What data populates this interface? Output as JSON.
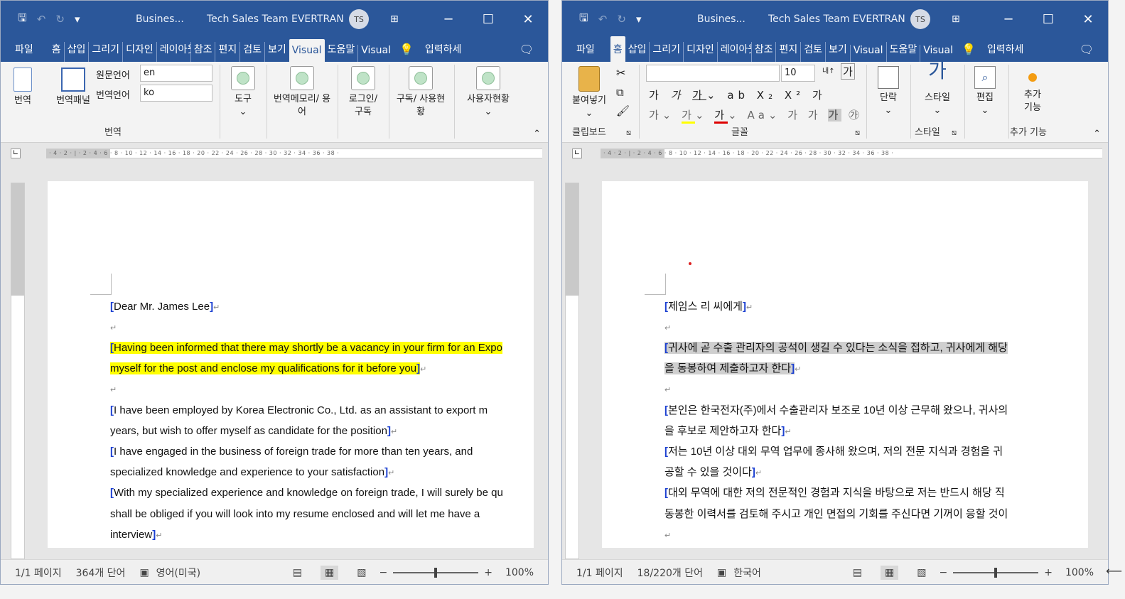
{
  "left": {
    "title": {
      "doc": "Busines...",
      "team": "Tech Sales Team EVERTRAN",
      "avatar": "TS"
    },
    "tabs": [
      "파일",
      "홈",
      "삽입",
      "그리기",
      "디자인",
      "레이아웃",
      "참조",
      "편지",
      "검토",
      "보기",
      "Visual",
      "도움말",
      "Visual"
    ],
    "active_tab_index": 10,
    "tellme": "입력하세",
    "ribbon": {
      "translate_label": "번역",
      "translate_pane_label": "번역패널",
      "source_lang_label": "원문언어",
      "source_lang_value": "en",
      "target_lang_label": "번역언어",
      "target_lang_value": "ko",
      "group_label": "번역",
      "tools_label": "도구",
      "memory_label": "번역메모리/ 용어",
      "login_label": "로그인/ 구독",
      "subscribe_label": "구독/ 사용현황",
      "usage_label": "사용자현황"
    },
    "doc": {
      "p1": "Dear Mr. James Lee",
      "p2a": "Having been informed that there may shortly be a vacancy in your firm for an Expo",
      "p2b": "myself for the post and enclose my qualifications for it before you",
      "p3a": "I have been employed by Korea Electronic Co., Ltd. as an assistant to export m",
      "p3b": "years, but wish to offer myself as candidate for the position",
      "p4a": "I have engaged in the business of foreign trade for more than ten years, and",
      "p4b": "specialized knowledge and experience to your satisfaction",
      "p5a": "With my specialized experience and knowledge on foreign trade, I will surely be qu",
      "p5b": "shall be obliged if you will look into my resume enclosed and will let me have a",
      "p5c": "interview"
    },
    "status": {
      "page": "1/1 페이지",
      "words": "364개 단어",
      "lang": "영어(미국)",
      "zoom": "100%"
    }
  },
  "right": {
    "title": {
      "doc": "Busines...",
      "team": "Tech Sales Team EVERTRAN",
      "avatar": "TS"
    },
    "tabs": [
      "파일",
      "홈",
      "삽입",
      "그리기",
      "디자인",
      "레이아웃",
      "참조",
      "편지",
      "검토",
      "보기",
      "Visual",
      "도움말",
      "Visual"
    ],
    "active_tab_index": 1,
    "tellme": "입력하세",
    "ribbon": {
      "paste_label": "붙여넣기",
      "clipboard_label": "클립보드",
      "font_size": "10",
      "font_label": "글꼴",
      "paragraph_label": "단락",
      "style_btn_label": "스타일",
      "style_group_label": "스타일",
      "edit_label": "편집",
      "addin_btn_label": "추가 기능",
      "addin_group_label": "추가 기능"
    },
    "doc": {
      "p1": "제임스 리 씨에게",
      "p2a": "귀사에 곧 수출 관리자의 공석이 생길 수 있다는 소식을 접하고, 귀사에게 해당",
      "p2b": "을 동봉하여 제출하고자 한다",
      "p3a": "본인은 한국전자(주)에서 수출관리자 보조로 10년 이상 근무해 왔으나, 귀사의",
      "p3b": "을 후보로 제안하고자 한다",
      "p4a": "저는 10년 이상 대외 무역 업무에 종사해 왔으며, 저의 전문 지식과 경험을 귀",
      "p4b": "공할 수 있을 것이다",
      "p5a": "대외 무역에 대한 저의 전문적인 경험과 지식을 바탕으로 저는 반드시 해당 직",
      "p5b": "동봉한 이력서를 검토해 주시고 개인 면접의 기회를 주신다면 기꺼이 응할 것이"
    },
    "status": {
      "page": "1/1 페이지",
      "words": "18/220개 단어",
      "lang": "한국어",
      "zoom": "100%"
    }
  }
}
